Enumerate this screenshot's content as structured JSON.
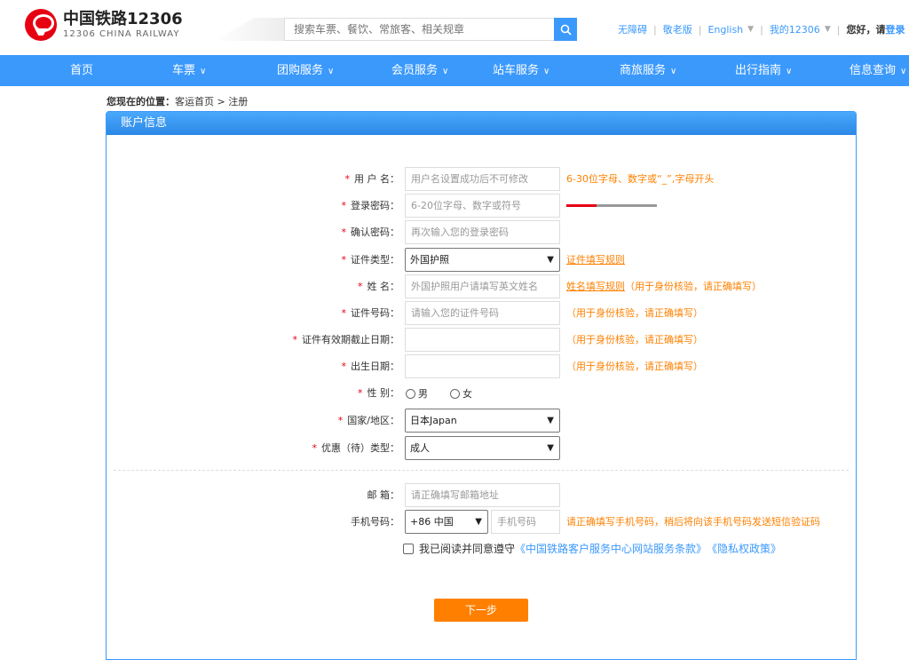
{
  "brand": {
    "name_cn": "中国铁路12306",
    "name_en": "12306 CHINA RAILWAY"
  },
  "search": {
    "placeholder": "搜索车票、餐饮、常旅客、相关规章"
  },
  "toplinks": {
    "accessibility": "无障碍",
    "elderly": "敬老版",
    "english": "English",
    "my12306": "我的12306",
    "greeting": "您好，请",
    "login": "登录"
  },
  "nav": [
    {
      "label": "首页",
      "has_menu": false
    },
    {
      "label": "车票",
      "has_menu": true
    },
    {
      "label": "团购服务",
      "has_menu": true
    },
    {
      "label": "会员服务",
      "has_menu": true
    },
    {
      "label": "站车服务",
      "has_menu": true
    },
    {
      "label": "商旅服务",
      "has_menu": true
    },
    {
      "label": "出行指南",
      "has_menu": true
    },
    {
      "label": "信息查询",
      "has_menu": true
    }
  ],
  "breadcrumb": {
    "prefix": "您现在的位置：",
    "home": "客运首页",
    "sep": ">",
    "current": "注册"
  },
  "panel": {
    "title": "账户信息"
  },
  "form": {
    "username": {
      "label": "用 户 名：",
      "placeholder": "用户名设置成功后不可修改",
      "hint": "6-30位字母、数字或“_”,字母开头"
    },
    "password": {
      "label": "登录密码：",
      "placeholder": "6-20位字母、数字或符号",
      "strength_level": 1
    },
    "confirm": {
      "label": "确认密码：",
      "placeholder": "再次输入您的登录密码"
    },
    "id_type": {
      "label": "证件类型：",
      "value": "外国护照",
      "hint_link": "证件填写规则"
    },
    "name": {
      "label": "姓 名：",
      "placeholder": "外国护照用户请填写英文姓名",
      "hint_link": "姓名填写规则",
      "hint": "（用于身份核验，请正确填写）"
    },
    "id_number": {
      "label": "证件号码：",
      "placeholder": "请输入您的证件号码",
      "hint": "（用于身份核验，请正确填写）"
    },
    "id_expiry": {
      "label": "证件有效期截止日期：",
      "hint": "（用于身份核验，请正确填写）"
    },
    "birth": {
      "label": "出生日期：",
      "hint": "（用于身份核验，请正确填写）"
    },
    "gender": {
      "label": "性 别：",
      "male": "男",
      "female": "女"
    },
    "country": {
      "label": "国家/地区：",
      "value": "日本Japan"
    },
    "discount": {
      "label": "优惠（待）类型：",
      "value": "成人"
    },
    "email": {
      "label": "邮 箱：",
      "placeholder": "请正确填写邮箱地址"
    },
    "phone": {
      "label": "手机号码：",
      "code": "+86 中国",
      "placeholder": "手机号码",
      "hint": "请正确填写手机号码，稍后将向该手机号码发送短信验证码"
    },
    "agree": {
      "text": "我已阅读并同意遵守",
      "terms": "《中国铁路客户服务中心网站服务条款》",
      "privacy": "《隐私权政策》"
    },
    "next": "下一步",
    "required_mark": "*"
  }
}
